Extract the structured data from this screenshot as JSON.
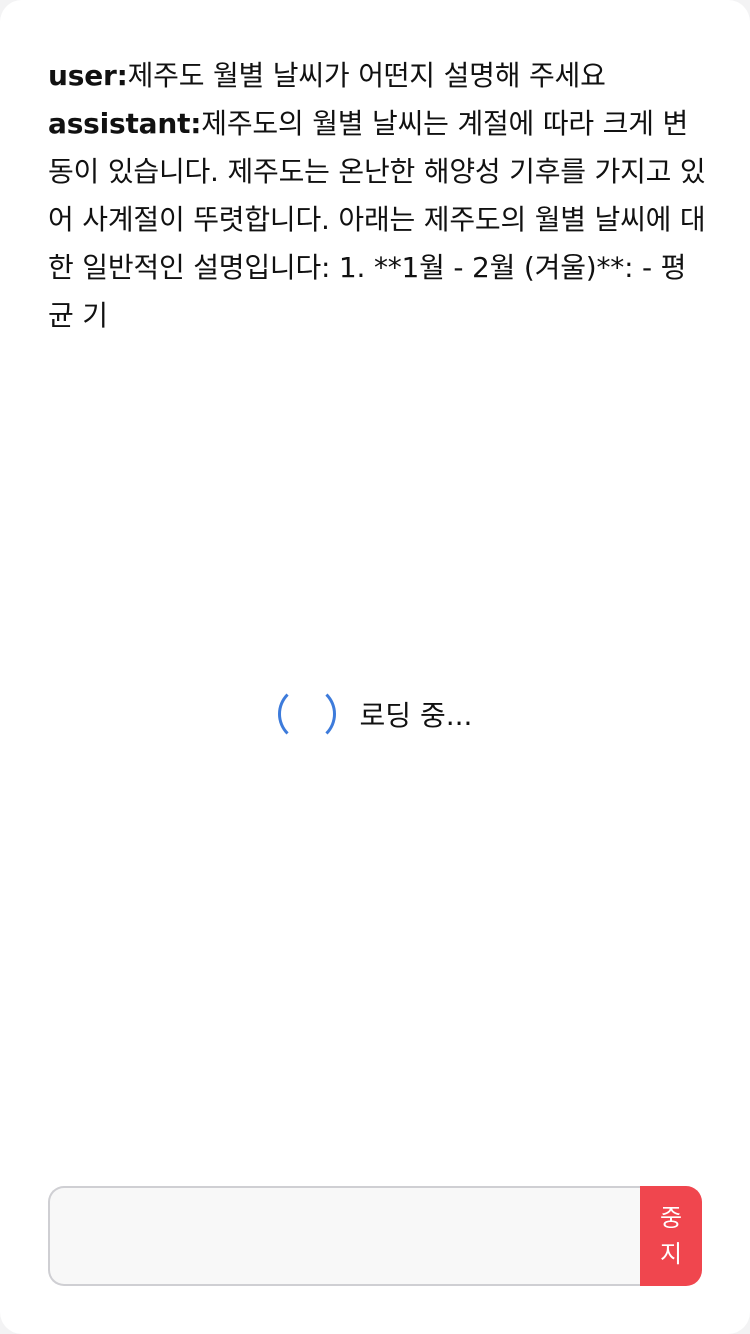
{
  "conversation": {
    "messages": [
      {
        "role": "user:",
        "text": "제주도 월별 날씨가 어떤지 설명해 주세요"
      },
      {
        "role": "assistant:",
        "text": "제주도의 월별 날씨는 계절에 따라 크게 변동이 있습니다. 제주도는 온난한 해양성 기후를 가지고 있어 사계절이 뚜렷합니다. 아래는 제주도의 월별 날씨에 대한 일반적인 설명입니다: 1. **1월 - 2월 (겨울)**: - 평균 기"
      }
    ]
  },
  "loading": {
    "text": "로딩 중..."
  },
  "composer": {
    "input_value": "",
    "input_placeholder": "",
    "stop_label": "중지"
  },
  "colors": {
    "spinner": "#3d7bdb",
    "stop_button": "#f0464e",
    "input_background": "#f8f8f8",
    "input_border": "#cfcfd3"
  },
  "icons": {
    "spinner": "loading-spinner-icon"
  }
}
